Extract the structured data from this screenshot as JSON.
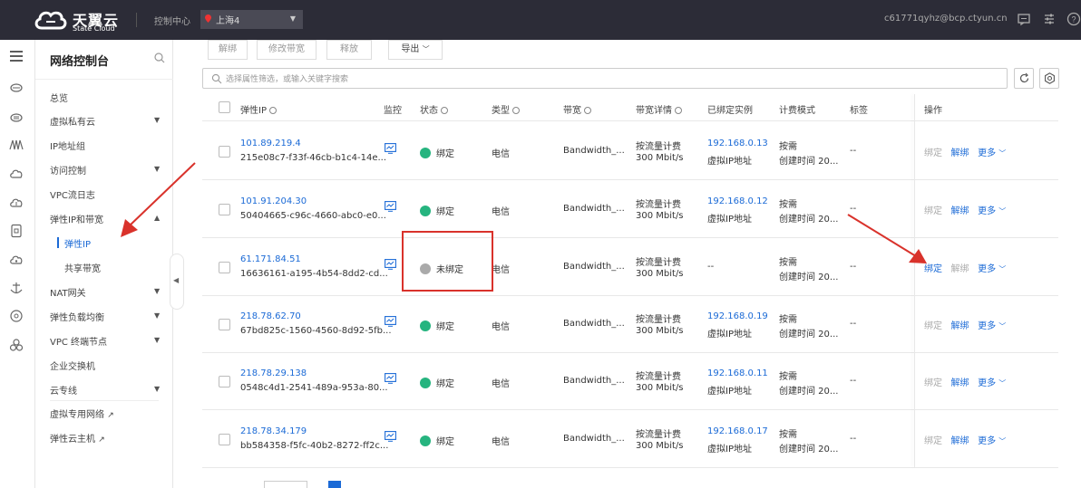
{
  "header": {
    "logo_cn": "天翼云",
    "logo_en": "State Cloud",
    "console": "控制中心",
    "region": "上海4",
    "user": "c61771qyhz@bcp.ctyun.cn"
  },
  "sidebar": {
    "title": "网络控制台",
    "items": [
      {
        "label": "总览"
      },
      {
        "label": "虚拟私有云"
      },
      {
        "label": "IP地址组"
      },
      {
        "label": "访问控制"
      },
      {
        "label": "VPC流日志"
      },
      {
        "label": "弹性IP和带宽"
      },
      {
        "label": "弹性IP"
      },
      {
        "label": "共享带宽"
      },
      {
        "label": "NAT网关"
      },
      {
        "label": "弹性负载均衡"
      },
      {
        "label": "VPC 终端节点"
      },
      {
        "label": "企业交换机"
      },
      {
        "label": "云专线"
      },
      {
        "label": "虚拟专用网络"
      },
      {
        "label": "弹性云主机"
      }
    ]
  },
  "toolbar": {
    "unbind": "解绑",
    "modify_bw": "修改带宽",
    "release": "释放",
    "export": "导出"
  },
  "search": {
    "placeholder": "选择属性筛选，或输入关键字搜索"
  },
  "table": {
    "columns": [
      "弹性IP",
      "监控",
      "状态",
      "类型",
      "带宽",
      "带宽详情",
      "已绑定实例",
      "计费模式",
      "标签",
      "操作"
    ],
    "rows": [
      {
        "ip": "101.89.219.4",
        "id": "215e08c7-f33f-46cb-b1c4-14e...",
        "status": "绑定",
        "type": "电信",
        "bw": "Bandwidth_...",
        "bw_mode": "按流量计费",
        "bw_rate": "300 Mbit/s",
        "instance_ip": "192.168.0.13",
        "instance_type": "虚拟IP地址",
        "billing": "按需",
        "created": "创建时间 20...",
        "tag": "--",
        "op1": "绑定",
        "op2": "解绑",
        "op3": "更多"
      },
      {
        "ip": "101.91.204.30",
        "id": "50404665-c96c-4660-abc0-e0...",
        "status": "绑定",
        "type": "电信",
        "bw": "Bandwidth_...",
        "bw_mode": "按流量计费",
        "bw_rate": "300 Mbit/s",
        "instance_ip": "192.168.0.12",
        "instance_type": "虚拟IP地址",
        "billing": "按需",
        "created": "创建时间 20...",
        "tag": "--",
        "op1": "绑定",
        "op2": "解绑",
        "op3": "更多"
      },
      {
        "ip": "61.171.84.51",
        "id": "16636161-a195-4b54-8dd2-cd...",
        "status": "未绑定",
        "type": "电信",
        "bw": "Bandwidth_...",
        "bw_mode": "按流量计费",
        "bw_rate": "300 Mbit/s",
        "instance_ip": "--",
        "instance_type": "",
        "billing": "按需",
        "created": "创建时间 20...",
        "tag": "--",
        "op1": "绑定",
        "op2": "解绑",
        "op3": "更多"
      },
      {
        "ip": "218.78.62.70",
        "id": "67bd825c-1560-4560-8d92-5fb...",
        "status": "绑定",
        "type": "电信",
        "bw": "Bandwidth_...",
        "bw_mode": "按流量计费",
        "bw_rate": "300 Mbit/s",
        "instance_ip": "192.168.0.19",
        "instance_type": "虚拟IP地址",
        "billing": "按需",
        "created": "创建时间 20...",
        "tag": "--",
        "op1": "绑定",
        "op2": "解绑",
        "op3": "更多"
      },
      {
        "ip": "218.78.29.138",
        "id": "0548c4d1-2541-489a-953a-80...",
        "status": "绑定",
        "type": "电信",
        "bw": "Bandwidth_...",
        "bw_mode": "按流量计费",
        "bw_rate": "300 Mbit/s",
        "instance_ip": "192.168.0.11",
        "instance_type": "虚拟IP地址",
        "billing": "按需",
        "created": "创建时间 20...",
        "tag": "--",
        "op1": "绑定",
        "op2": "解绑",
        "op3": "更多"
      },
      {
        "ip": "218.78.34.179",
        "id": "bb584358-f5fc-40b2-8272-ff2c...",
        "status": "绑定",
        "type": "电信",
        "bw": "Bandwidth_...",
        "bw_mode": "按流量计费",
        "bw_rate": "300 Mbit/s",
        "instance_ip": "192.168.0.17",
        "instance_type": "虚拟IP地址",
        "billing": "按需",
        "created": "创建时间 20...",
        "tag": "--",
        "op1": "绑定",
        "op2": "解绑",
        "op3": "更多"
      }
    ]
  },
  "colors": {
    "topbar": "#2c2c37",
    "link": "#1b6ad6",
    "bound": "#26b47f",
    "unbound": "#aaaaaa",
    "annotation": "#d9322b"
  }
}
